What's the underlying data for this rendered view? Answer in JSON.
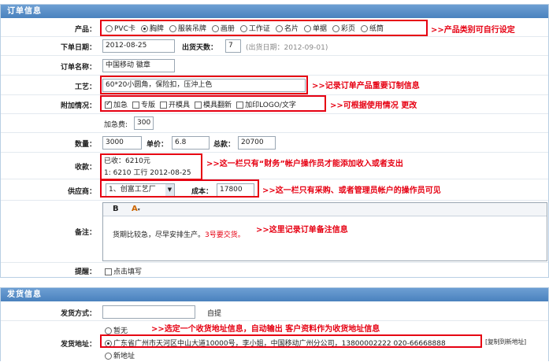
{
  "order_section": {
    "header": "订单信息",
    "product": {
      "label": "产品：",
      "options": [
        "PVC卡",
        "胸牌",
        "服装吊牌",
        "画册",
        "工作证",
        "名片",
        "单据",
        "彩页",
        "纸筒"
      ],
      "selected": "胸牌"
    },
    "product_note": ">>产品类别可自行设定",
    "order_date": {
      "label": "下单日期：",
      "value": "2012-08-25"
    },
    "ship_days": {
      "label": "出货天数：",
      "value": "7",
      "hint": "(出货日期：2012-09-01)"
    },
    "order_name": {
      "label": "订单名称：",
      "value": "中国移动 徽章"
    },
    "craft": {
      "label": "工艺：",
      "value": "60*20小圆角，保险扣，压沖上色"
    },
    "craft_note": ">>记录订单产品重要订制信息",
    "extra": {
      "label": "附加情况：",
      "options": [
        {
          "text": "加急",
          "checked": true
        },
        {
          "text": "专版",
          "checked": false
        },
        {
          "text": "开模具",
          "checked": false
        },
        {
          "text": "模具翻新",
          "checked": false
        },
        {
          "text": "加印LOGO/文字",
          "checked": false
        }
      ]
    },
    "extra_note": ">>可根据使用情况 更改",
    "rush_fee": {
      "label": "加急费:",
      "value": "300"
    },
    "quantity": {
      "label": "数量：",
      "value": "3000"
    },
    "unit_price": {
      "label": "单价：",
      "value": "6.8"
    },
    "total": {
      "label": "总款：",
      "value": "20700"
    },
    "receipt": {
      "label": "收款：",
      "line1": "已收：6210元",
      "line2": "1: 6210 工行 2012-08-25"
    },
    "receipt_note": ">>这一栏只有“财务”帐户操作员才能添加收入或者支出",
    "supplier": {
      "label": "供应商：",
      "value": "1、创富工艺厂",
      "cost_label": "成本：",
      "cost_value": "17800"
    },
    "supplier_note": ">>这一栏只有采购、或者管理员帐户的操作员可见",
    "remark": {
      "label": "备注：",
      "text_plain": "货期比较急，尽早安排生产。",
      "text_red": "3号要交货。",
      "bold_btn": "B",
      "color_btn": "A"
    },
    "remark_note": ">>这里记录订单备注信息",
    "reminder": {
      "label": "提醒：",
      "text": "点击填写"
    }
  },
  "ship_section": {
    "header": "发货信息",
    "ship_method": {
      "label": "发货方式：",
      "value": "",
      "option": "自提"
    },
    "address": {
      "label": "发货地址：",
      "none": "暂无",
      "selected": "广东省广州市天河区中山大道10000号，李小姐，中国移动广州分公司，13800002222  020-66668888",
      "copy_link": "[复制到新地址]",
      "new": "新地址"
    },
    "address_note": ">>选定一个收货地址信息，自动输出 客户资料作为收货地址信息"
  },
  "colors": {
    "accent": "#e60012",
    "header": "#4a82be",
    "border": "#b9cfe4"
  }
}
